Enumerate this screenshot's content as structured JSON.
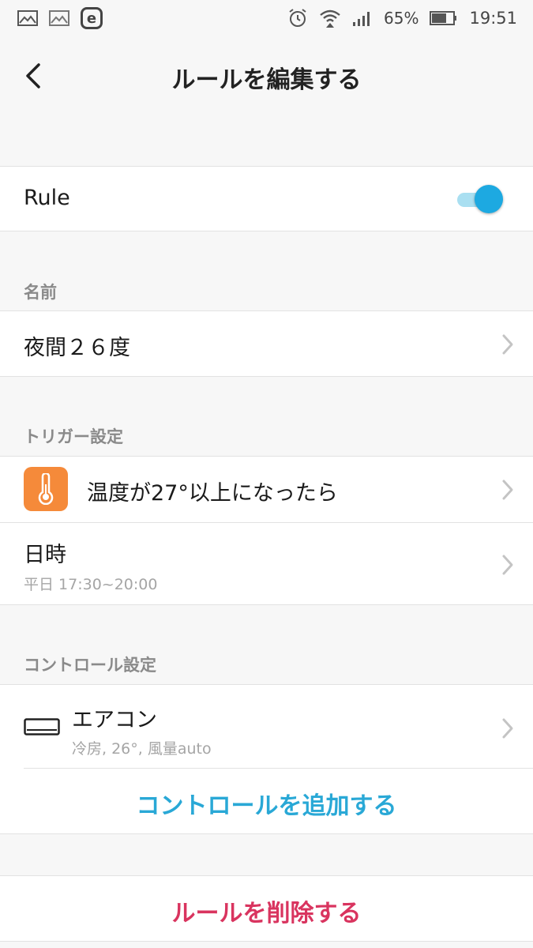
{
  "status_bar": {
    "battery": "65%",
    "time": "19:51",
    "icons": [
      "image-icon",
      "image-icon",
      "e-app-icon",
      "alarm-icon",
      "wifi-icon",
      "signal-icon",
      "battery-icon"
    ]
  },
  "header": {
    "title": "ルールを編集する",
    "back_icon": "chevron-left-icon"
  },
  "rule": {
    "label": "Rule",
    "enabled": true
  },
  "name_section": {
    "label": "名前",
    "value": "夜間２６度"
  },
  "trigger_section": {
    "label": "トリガー設定",
    "items": [
      {
        "icon": "thermometer-icon",
        "title": "温度が27°以上になったら"
      },
      {
        "title": "日時",
        "subtitle": "平日 17:30~20:00"
      }
    ]
  },
  "control_section": {
    "label": "コントロール設定",
    "items": [
      {
        "icon": "air-conditioner-icon",
        "title": "エアコン",
        "subtitle": "冷房, 26°, 風量auto"
      }
    ],
    "add_label": "コントロールを追加する"
  },
  "delete_label": "ルールを削除する",
  "colors": {
    "accent": "#1da9e1",
    "add_text": "#29a8d6",
    "delete_text": "#d9345f",
    "thermo_bg": "#f58a3a"
  }
}
